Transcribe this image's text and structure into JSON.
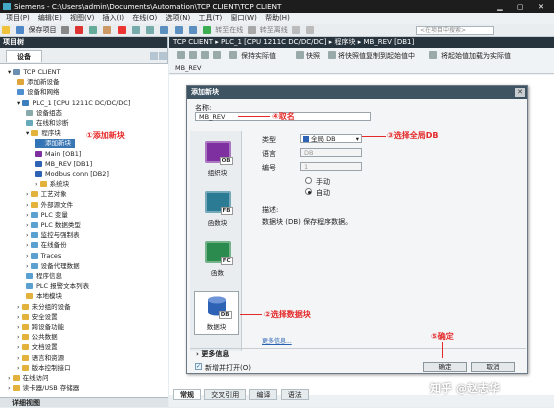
{
  "window": {
    "title": "Siemens - C:\\Users\\admin\\Documents\\Automation\\TCP CLIENT\\TCP CLIENT"
  },
  "menubar": [
    "项目(P)",
    "编辑(E)",
    "视图(V)",
    "插入(I)",
    "在线(O)",
    "选项(N)",
    "工具(T)",
    "窗口(W)",
    "帮助(H)"
  ],
  "toolbar": {
    "save_label": "保存项目",
    "go_online": "转至在线",
    "go_offline": "转至离线",
    "search_placeholder": "<在项目中搜索>"
  },
  "left_panel": {
    "header": "项目树",
    "devices_tab": "设备",
    "tree": [
      {
        "label": "TCP CLIENT",
        "level": 0
      },
      {
        "label": "添加新设备",
        "level": 1
      },
      {
        "label": "设备和网络",
        "level": 1
      },
      {
        "label": "PLC_1 [CPU 1211C DC/DC/DC]",
        "level": 1
      },
      {
        "label": "设备组态",
        "level": 2
      },
      {
        "label": "在线和诊断",
        "level": 2
      },
      {
        "label": "程序块",
        "level": 2
      },
      {
        "label": "添加新块",
        "level": 3,
        "selected": true
      },
      {
        "label": "Main [OB1]",
        "level": 3
      },
      {
        "label": "MB_REV [DB1]",
        "level": 3
      },
      {
        "label": "Modbus conn [DB2]",
        "level": 3
      },
      {
        "label": "系统块",
        "level": 3
      },
      {
        "label": "工艺对象",
        "level": 2
      },
      {
        "label": "外部源文件",
        "level": 2
      },
      {
        "label": "PLC 变量",
        "level": 2
      },
      {
        "label": "PLC 数据类型",
        "level": 2
      },
      {
        "label": "监控与强制表",
        "level": 2
      },
      {
        "label": "在线备份",
        "level": 2
      },
      {
        "label": "Traces",
        "level": 2
      },
      {
        "label": "设备代理数据",
        "level": 2
      },
      {
        "label": "程序信息",
        "level": 2
      },
      {
        "label": "PLC 报警文本列表",
        "level": 2
      },
      {
        "label": "本地模块",
        "level": 2
      },
      {
        "label": "未分组的设备",
        "level": 1
      },
      {
        "label": "安全设置",
        "level": 1
      },
      {
        "label": "跨设备功能",
        "level": 1
      },
      {
        "label": "公共数据",
        "level": 1
      },
      {
        "label": "文档设置",
        "level": 1
      },
      {
        "label": "语言和资源",
        "level": 1
      },
      {
        "label": "版本控制接口",
        "level": 1
      },
      {
        "label": "在线访问",
        "level": 0
      },
      {
        "label": "读卡器/USB 存储器",
        "level": 0
      }
    ],
    "details_view": "详细视图"
  },
  "editor": {
    "breadcrumb": "TCP CLIENT ▸ PLC_1 [CPU 1211C DC/DC/DC] ▸ 程序块 ▸ MB_REV [DB1]",
    "tool_keep": "保持实际值",
    "tool_snapshot": "快照",
    "tool_copy1": "将快照值复制到起始值中",
    "tool_copy2": "将起始值加载为实际值",
    "db_name": "MB_REV"
  },
  "dialog": {
    "title": "添加新块",
    "name_label": "名称:",
    "name_value": "MB_REV",
    "type_label": "类型",
    "type_value": "全局 DB",
    "language_label": "语言",
    "language_value": "DB",
    "number_label": "编号",
    "number_value": "1",
    "manual_label": "手动",
    "auto_label": "自动",
    "desc_label": "描述:",
    "desc_text": "数据块 (DB) 保存程序数据。",
    "more_link": "更多信息...",
    "more_info": "更多信息",
    "open_checkbox": "新增并打开(O)",
    "ok_button": "确定",
    "cancel_button": "取消",
    "blocks": [
      {
        "badge": "OB",
        "label": "组织块",
        "color": "#7e2fa0"
      },
      {
        "badge": "FB",
        "label": "函数块",
        "color": "#2c7b95"
      },
      {
        "badge": "FC",
        "label": "函数",
        "color": "#2b8a4e"
      },
      {
        "badge": "DB",
        "label": "数据块",
        "color": "#2e62b5"
      }
    ]
  },
  "annotations": {
    "a1": "①添加新块",
    "a2": "②选择数据块",
    "a3": "③选择全局DB",
    "a4": "④取名",
    "a5": "⑤确定"
  },
  "bottom_tabs": [
    "常规",
    "交叉引用",
    "编译",
    "语法"
  ],
  "watermark": "知乎 @赵志华"
}
